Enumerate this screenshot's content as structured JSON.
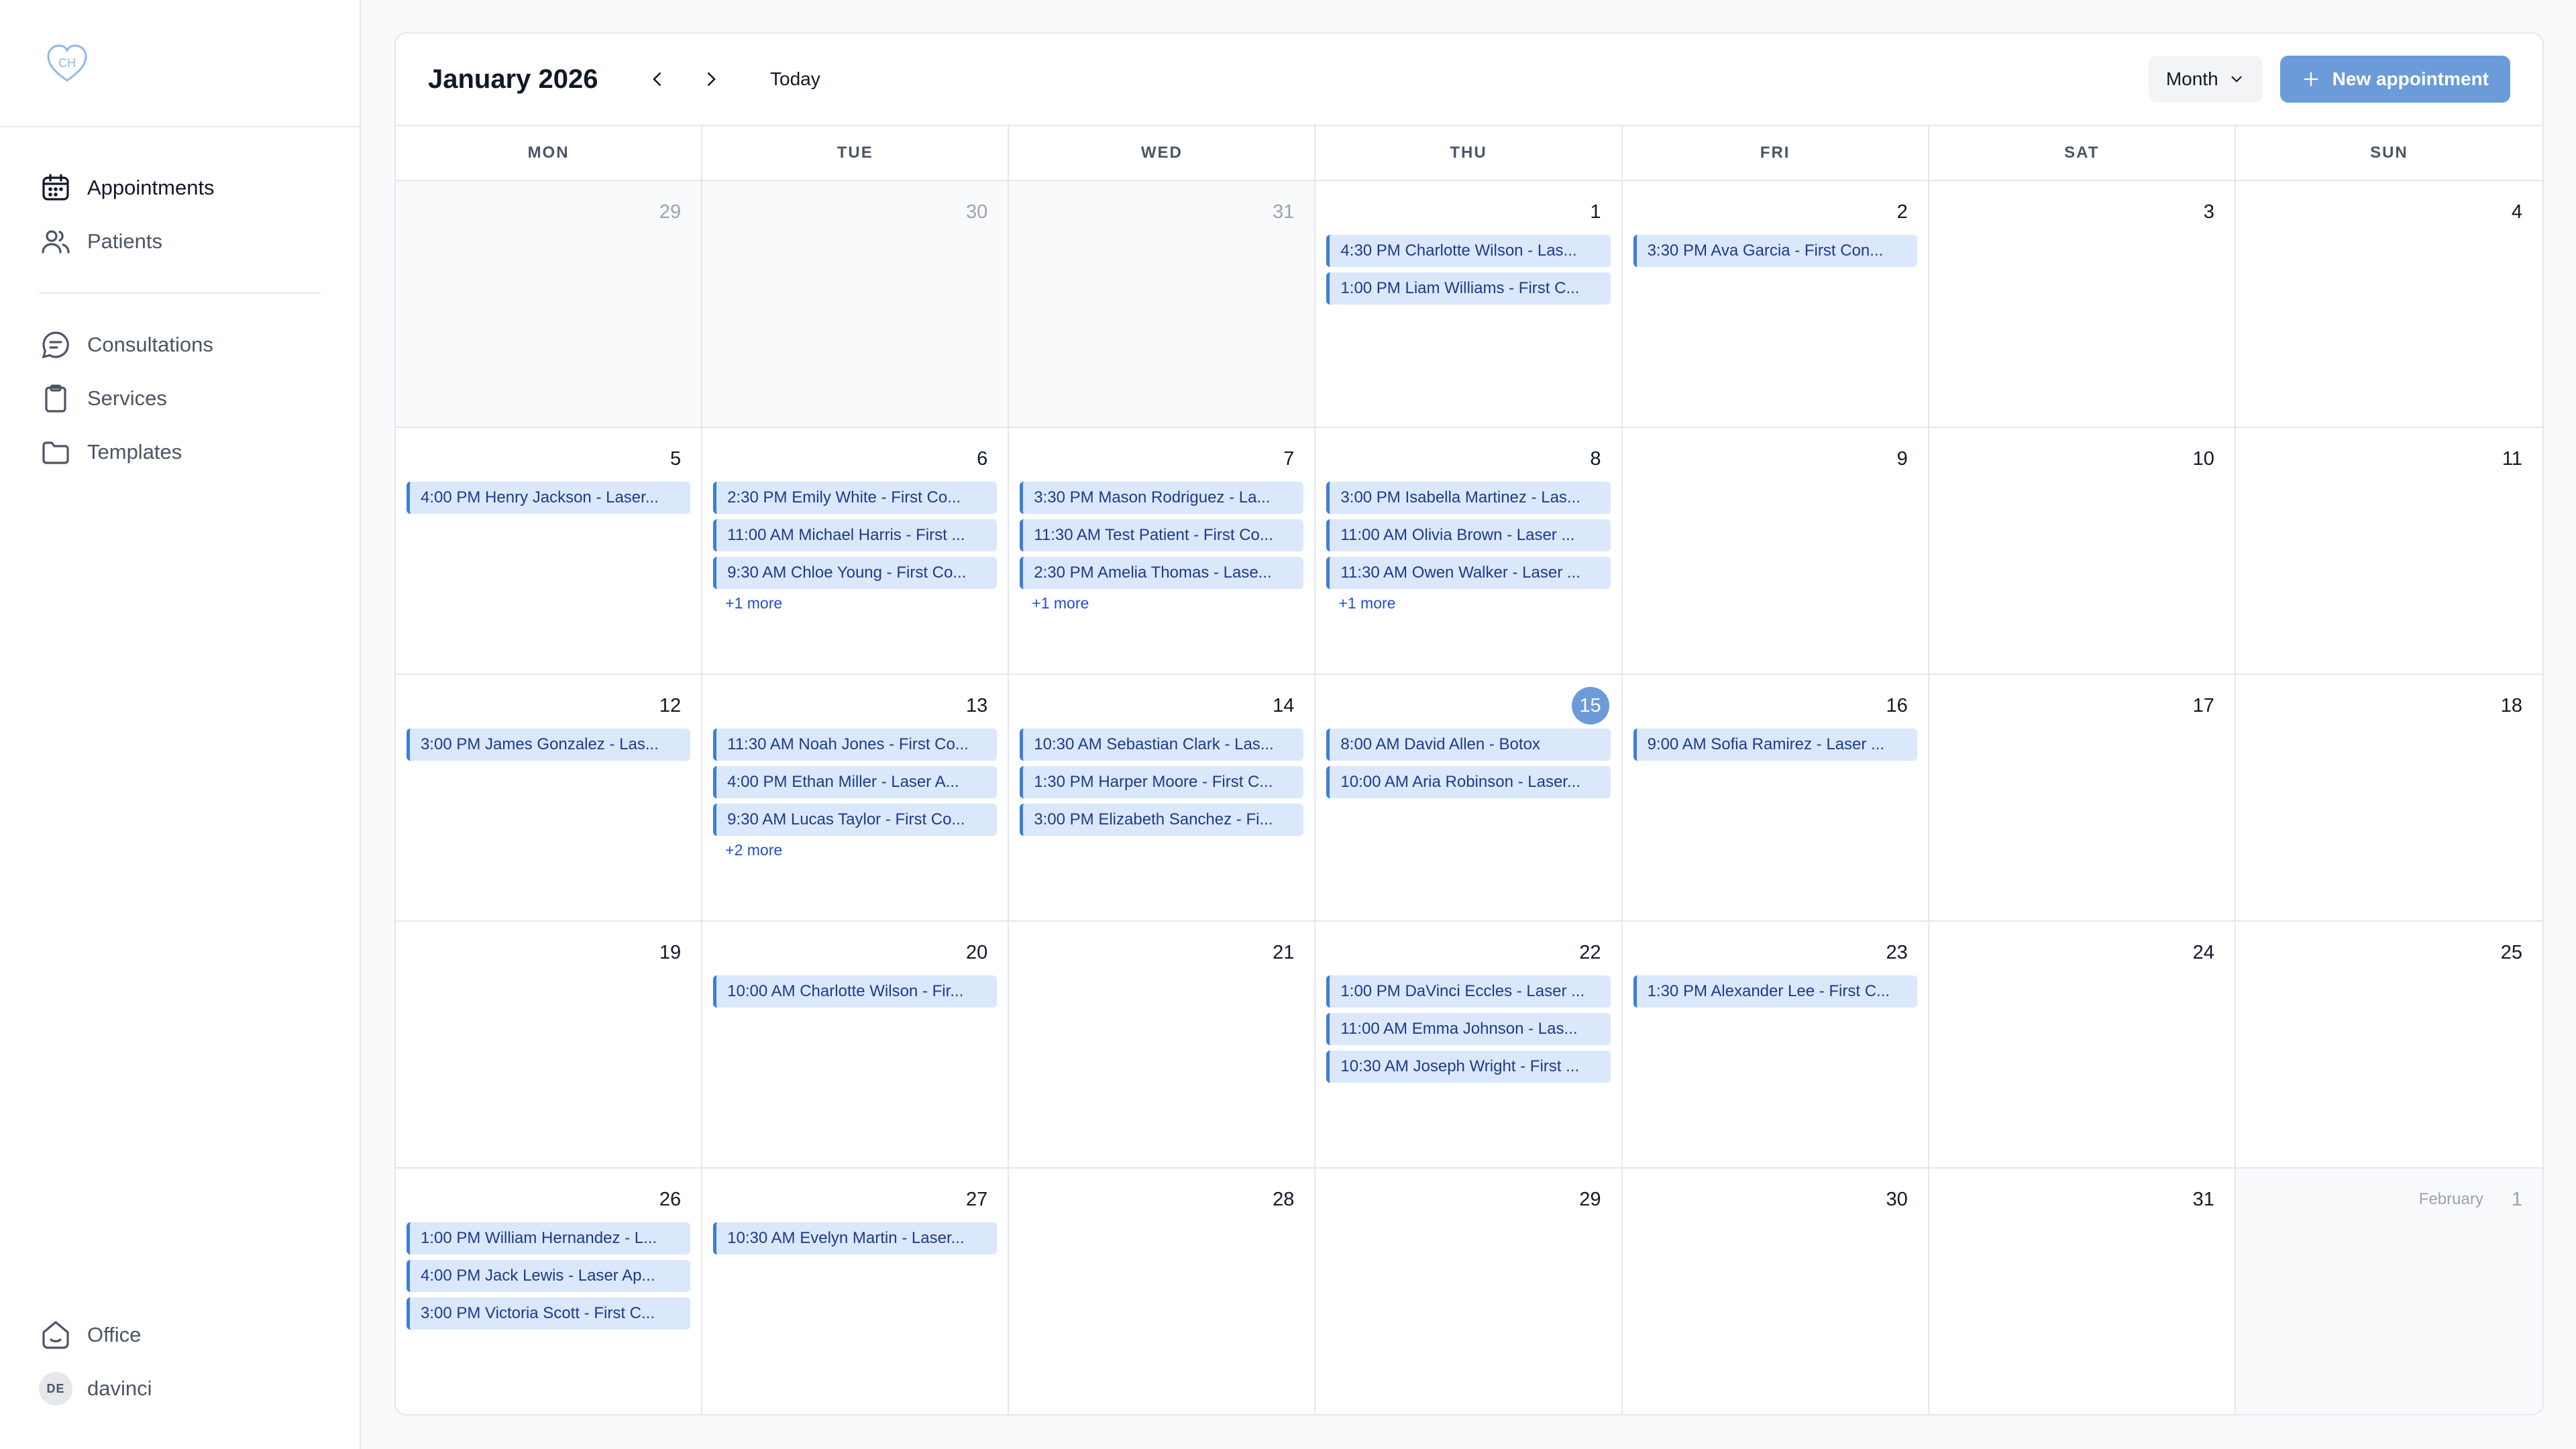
{
  "sidebar": {
    "nav": [
      {
        "label": "Appointments",
        "icon": "calendar-icon",
        "active": true
      },
      {
        "label": "Patients",
        "icon": "users-icon",
        "active": false
      }
    ],
    "nav2": [
      {
        "label": "Consultations",
        "icon": "chat-icon"
      },
      {
        "label": "Services",
        "icon": "clipboard-icon"
      },
      {
        "label": "Templates",
        "icon": "folder-icon"
      }
    ],
    "office_label": "Office",
    "user": {
      "initials": "DE",
      "name": "davinci"
    }
  },
  "calendar": {
    "title": "January 2026",
    "today_label": "Today",
    "view_label": "Month",
    "new_label": "New appointment",
    "weekdays": [
      "MON",
      "TUE",
      "WED",
      "THU",
      "FRI",
      "SAT",
      "SUN"
    ],
    "days": [
      {
        "num": "29",
        "outside": true,
        "events": []
      },
      {
        "num": "30",
        "outside": true,
        "events": []
      },
      {
        "num": "31",
        "outside": true,
        "events": []
      },
      {
        "num": "1",
        "events": [
          "4:30 PM Charlotte Wilson - Las...",
          "1:00 PM Liam Williams - First C..."
        ]
      },
      {
        "num": "2",
        "events": [
          "3:30 PM Ava Garcia - First Con..."
        ]
      },
      {
        "num": "3",
        "events": []
      },
      {
        "num": "4",
        "events": []
      },
      {
        "num": "5",
        "events": [
          "4:00 PM Henry Jackson - Laser..."
        ]
      },
      {
        "num": "6",
        "events": [
          "2:30 PM Emily White - First Co...",
          "11:00 AM Michael Harris - First ...",
          "9:30 AM Chloe Young - First Co..."
        ],
        "more": "+1 more"
      },
      {
        "num": "7",
        "events": [
          "3:30 PM Mason Rodriguez - La...",
          "11:30 AM Test Patient - First Co...",
          "2:30 PM Amelia Thomas - Lase..."
        ],
        "more": "+1 more"
      },
      {
        "num": "8",
        "events": [
          "3:00 PM Isabella Martinez - Las...",
          "11:00 AM Olivia Brown - Laser ...",
          "11:30 AM Owen Walker - Laser ..."
        ],
        "more": "+1 more"
      },
      {
        "num": "9",
        "events": []
      },
      {
        "num": "10",
        "events": []
      },
      {
        "num": "11",
        "events": []
      },
      {
        "num": "12",
        "events": [
          "3:00 PM James Gonzalez - Las..."
        ]
      },
      {
        "num": "13",
        "events": [
          "11:30 AM Noah Jones - First Co...",
          "4:00 PM Ethan Miller - Laser A...",
          "9:30 AM Lucas Taylor - First Co..."
        ],
        "more": "+2 more"
      },
      {
        "num": "14",
        "events": [
          "10:30 AM Sebastian Clark - Las...",
          "1:30 PM Harper Moore - First C...",
          "3:00 PM Elizabeth Sanchez - Fi..."
        ]
      },
      {
        "num": "15",
        "today": true,
        "events": [
          "8:00 AM David Allen - Botox",
          "10:00 AM Aria Robinson - Laser..."
        ]
      },
      {
        "num": "16",
        "events": [
          "9:00 AM Sofia Ramirez - Laser ..."
        ]
      },
      {
        "num": "17",
        "events": []
      },
      {
        "num": "18",
        "events": []
      },
      {
        "num": "19",
        "events": []
      },
      {
        "num": "20",
        "events": [
          "10:00 AM Charlotte Wilson - Fir..."
        ]
      },
      {
        "num": "21",
        "events": []
      },
      {
        "num": "22",
        "events": [
          "1:00 PM DaVinci Eccles - Laser ...",
          "11:00 AM Emma Johnson - Las...",
          "10:30 AM Joseph Wright - First ..."
        ]
      },
      {
        "num": "23",
        "events": [
          "1:30 PM Alexander Lee - First C..."
        ]
      },
      {
        "num": "24",
        "events": []
      },
      {
        "num": "25",
        "events": []
      },
      {
        "num": "26",
        "events": [
          "1:00 PM William Hernandez - L...",
          "4:00 PM Jack Lewis - Laser Ap...",
          "3:00 PM Victoria Scott - First C..."
        ]
      },
      {
        "num": "27",
        "events": [
          "10:30 AM Evelyn Martin - Laser..."
        ]
      },
      {
        "num": "28",
        "events": []
      },
      {
        "num": "29",
        "events": []
      },
      {
        "num": "30",
        "events": []
      },
      {
        "num": "31",
        "events": []
      },
      {
        "num": "1",
        "outside": true,
        "month_label": "February",
        "events": []
      }
    ]
  },
  "colors": {
    "accent": "#6b9bd8",
    "event_bg": "#dbe8fb",
    "event_border": "#3b7ed8",
    "event_text": "#1e3a8a"
  }
}
